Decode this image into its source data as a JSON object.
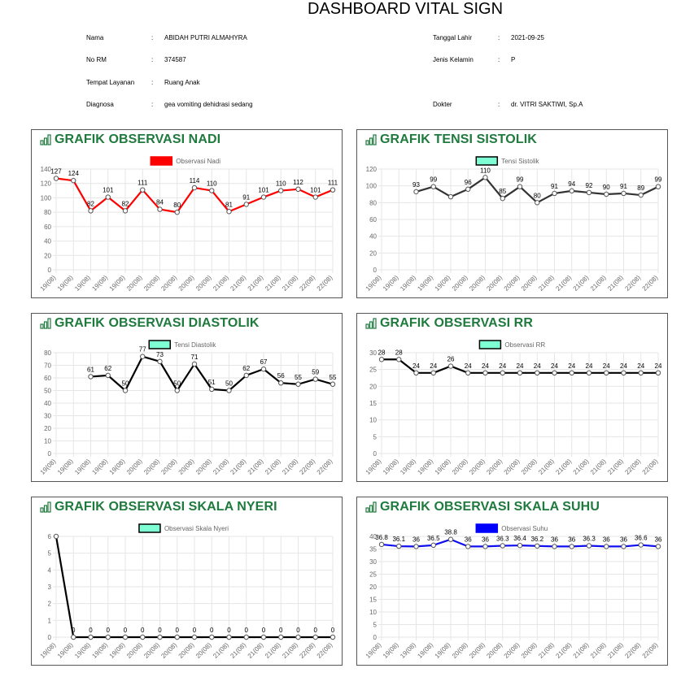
{
  "page_title": "DASHBOARD VITAL SIGN",
  "patient_left": [
    {
      "label": "Nama",
      "sep": ":",
      "value": "ABIDAH PUTRI ALMAHYRA"
    },
    {
      "label": "No RM",
      "sep": ":",
      "value": "374587"
    },
    {
      "label": "Tempat Layanan",
      "sep": ":",
      "value": "Ruang Anak"
    },
    {
      "label": "Diagnosa",
      "sep": ":",
      "value": "gea vomiting dehidrasi sedang"
    }
  ],
  "patient_right": [
    {
      "label": "Tanggal Lahir",
      "sep": ":",
      "value": "2021-09-25"
    },
    {
      "label": "Jenis Kelamin",
      "sep": ":",
      "value": "P"
    },
    {
      "label": "Dokter",
      "sep": ":",
      "value": "dr. VITRI SAKTIWI, Sp.A"
    }
  ],
  "icon": "bar-chart-icon",
  "colors": {
    "title_green": "#1f7a3d",
    "grid": "#e6e6e6",
    "axis_text": "#666666"
  },
  "chart_data": [
    {
      "id": "nadi",
      "panel_title": "GRAFIK OBSERVASI NADI",
      "type": "line",
      "legend": "Observasi Nadi",
      "line_color": "#ff0000",
      "legend_fill": "#ff0000",
      "legend_stroke": "#ff0000",
      "ylim": [
        0,
        140
      ],
      "ystep": 20,
      "categories": [
        "19(08)",
        "19(08)",
        "19(08)",
        "19(08)",
        "19(08)",
        "20(08)",
        "20(08)",
        "20(08)",
        "20(08)",
        "20(08)",
        "21(08)",
        "21(08)",
        "21(08)",
        "21(08)",
        "21(08)",
        "22(08)",
        "22(08)"
      ],
      "values": [
        127,
        124,
        82,
        101,
        82,
        111,
        84,
        80,
        114,
        110,
        81,
        91,
        101,
        110,
        112,
        101,
        111
      ]
    },
    {
      "id": "sistolik",
      "panel_title": "GRAFIK TENSI SISTOLIK",
      "type": "line",
      "legend": "Tensi Sistolik",
      "line_color": "#333333",
      "legend_fill": "#7fffd4",
      "legend_stroke": "#000000",
      "ylim": [
        0,
        120
      ],
      "ystep": 20,
      "categories": [
        "19(08)",
        "19(08)",
        "19(08)",
        "19(08)",
        "19(08)",
        "20(08)",
        "20(08)",
        "20(08)",
        "20(08)",
        "20(08)",
        "21(08)",
        "21(08)",
        "21(08)",
        "21(08)",
        "21(08)",
        "22(08)",
        "22(08)"
      ],
      "values": [
        null,
        null,
        93,
        99,
        87,
        96,
        110,
        85,
        99,
        80,
        91,
        94,
        92,
        90,
        91,
        89,
        99
      ],
      "labels": [
        null,
        null,
        "93",
        "99",
        "",
        "96",
        "110",
        "85",
        "99",
        "80",
        "91",
        "94",
        "92",
        "90",
        "91",
        "89",
        "99"
      ]
    },
    {
      "id": "diastolik",
      "panel_title": "GRAFIK OBSERVASI DIASTOLIK",
      "type": "line",
      "legend": "Tensi Diastolik",
      "line_color": "#000000",
      "legend_fill": "#7fffd4",
      "legend_stroke": "#000000",
      "ylim": [
        0,
        80
      ],
      "ystep": 10,
      "categories": [
        "19(08)",
        "19(08)",
        "19(08)",
        "19(08)",
        "19(08)",
        "20(08)",
        "20(08)",
        "20(08)",
        "20(08)",
        "20(08)",
        "21(08)",
        "21(08)",
        "21(08)",
        "21(08)",
        "21(08)",
        "22(08)",
        "22(08)"
      ],
      "values": [
        null,
        null,
        61,
        62,
        50,
        77,
        73,
        50,
        71,
        51,
        50,
        62,
        67,
        56,
        55,
        59,
        55
      ]
    },
    {
      "id": "rr",
      "panel_title": "GRAFIK OBSERVASI RR",
      "type": "line",
      "legend": "Observasi RR",
      "line_color": "#000000",
      "legend_fill": "#7fffd4",
      "legend_stroke": "#000000",
      "ylim": [
        0,
        30
      ],
      "ystep": 5,
      "categories": [
        "19(08)",
        "19(08)",
        "19(08)",
        "19(08)",
        "19(08)",
        "20(08)",
        "20(08)",
        "20(08)",
        "20(08)",
        "20(08)",
        "21(08)",
        "21(08)",
        "21(08)",
        "21(08)",
        "21(08)",
        "22(08)",
        "22(08)"
      ],
      "values": [
        28,
        28,
        24,
        24,
        26,
        24,
        24,
        24,
        24,
        24,
        24,
        24,
        24,
        24,
        24,
        24,
        24
      ]
    },
    {
      "id": "nyeri",
      "panel_title": "GRAFIK OBSERVASI SKALA NYERI",
      "type": "line",
      "legend": "Observasi Skala Nyeri",
      "line_color": "#000000",
      "legend_fill": "#7fffd4",
      "legend_stroke": "#000000",
      "ylim": [
        0,
        6
      ],
      "ystep": 1,
      "categories": [
        "19(08)",
        "19(08)",
        "19(08)",
        "19(08)",
        "19(08)",
        "20(08)",
        "20(08)",
        "20(08)",
        "20(08)",
        "20(08)",
        "21(08)",
        "21(08)",
        "21(08)",
        "21(08)",
        "21(08)",
        "22(08)",
        "22(08)"
      ],
      "values": [
        6,
        0,
        0,
        0,
        0,
        0,
        0,
        0,
        0,
        0,
        0,
        0,
        0,
        0,
        0,
        0,
        0
      ],
      "labels": [
        "",
        "0",
        "0",
        "0",
        "0",
        "0",
        "0",
        "0",
        "0",
        "0",
        "0",
        "0",
        "0",
        "0",
        "0",
        "0",
        "0"
      ]
    },
    {
      "id": "suhu",
      "panel_title": "GRAFIK OBSERVASI SKALA SUHU",
      "type": "line",
      "legend": "Observasi Suhu",
      "line_color": "#1010ee",
      "legend_fill": "#0000ff",
      "legend_stroke": "#0000ff",
      "ylim": [
        0,
        40
      ],
      "ystep": 5,
      "categories": [
        "19(08)",
        "19(08)",
        "19(08)",
        "19(08)",
        "19(08)",
        "20(08)",
        "20(08)",
        "20(08)",
        "20(08)",
        "20(08)",
        "21(08)",
        "21(08)",
        "21(08)",
        "21(08)",
        "21(08)",
        "22(08)",
        "22(08)"
      ],
      "values": [
        36.8,
        36.1,
        36,
        36.5,
        38.8,
        36,
        36,
        36.3,
        36.4,
        36.2,
        36,
        36,
        36.3,
        36,
        36,
        36.6,
        36
      ],
      "labels": [
        "36.8",
        "36.1",
        "36",
        "36.5",
        "38.8",
        "36",
        "36",
        "36.3",
        "36.4",
        "36.2",
        "36",
        "36",
        "36.3",
        "36",
        "36",
        "36.6",
        "36"
      ]
    }
  ]
}
